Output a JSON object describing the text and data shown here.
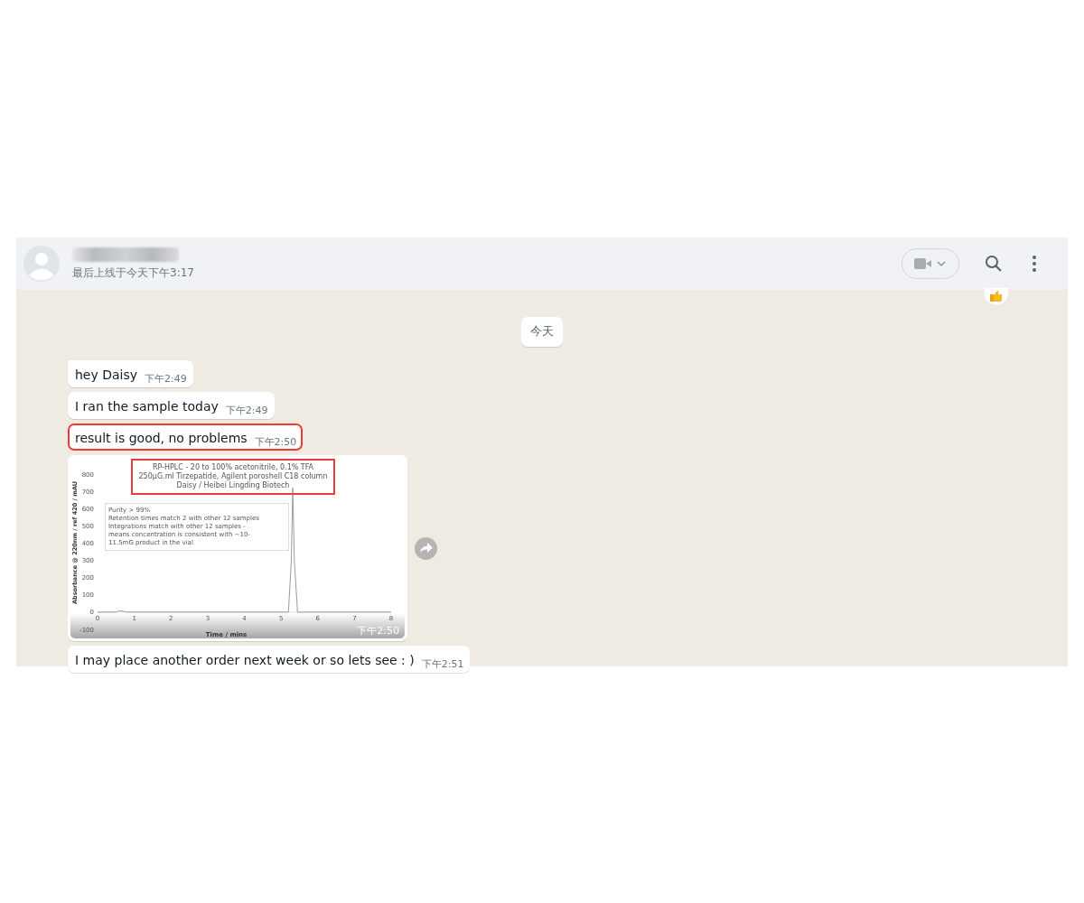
{
  "header": {
    "status": "最后上线于今天下午3:17"
  },
  "date_chip": "今天",
  "messages": [
    {
      "kind": "text",
      "text": "hey Daisy",
      "time": "下午2:49",
      "first": true,
      "highlighted": false
    },
    {
      "kind": "text",
      "text": "I ran the sample today",
      "time": "下午2:49",
      "first": false,
      "highlighted": false
    },
    {
      "kind": "text",
      "text": "result is good, no problems",
      "time": "下午2:50",
      "first": false,
      "highlighted": true
    },
    {
      "kind": "image",
      "time": "下午2:50",
      "first": false,
      "highlighted": false,
      "chart": {
        "caption_lines": [
          "RP-HPLC - 20 to 100% acetonitrile, 0.1% TFA",
          "250µG.ml Tirzepatide, Agilent poroshell C18 column",
          "Daisy / Heibei Lingding Biotech"
        ],
        "caption_highlighted": true,
        "note_lines": [
          "Purity > 99%",
          "Retention times match 2 with other 12 samples",
          "Integrations match with other 12 samples -",
          "means concentration is consistent with ~10-",
          "11.5mG product in the vial"
        ],
        "chart_data": {
          "type": "line",
          "xlabel": "Time / mins",
          "ylabel": "Absorbance @ 220nm / ref 420 / mAU",
          "x": [
            0,
            0.5,
            0.6,
            0.7,
            0.8,
            1,
            5.2,
            5.28,
            5.32,
            5.36,
            5.45,
            6,
            8
          ],
          "series": [
            {
              "color": "#9a9a9a",
              "values": [
                0,
                0,
                8,
                5,
                0,
                0,
                0,
                300,
                720,
                300,
                0,
                0,
                0
              ]
            }
          ],
          "xlim": [
            0,
            8
          ],
          "ylim": [
            -100,
            800
          ],
          "xticks": [
            0,
            1,
            2,
            3,
            4,
            5,
            6,
            7,
            8
          ],
          "yticks": [
            -100,
            0,
            100,
            200,
            300,
            400,
            500,
            600,
            700,
            800
          ]
        }
      }
    },
    {
      "kind": "text",
      "text": "I may place another order next week or so lets see : )",
      "time": "下午2:51",
      "first": false,
      "highlighted": false
    }
  ]
}
